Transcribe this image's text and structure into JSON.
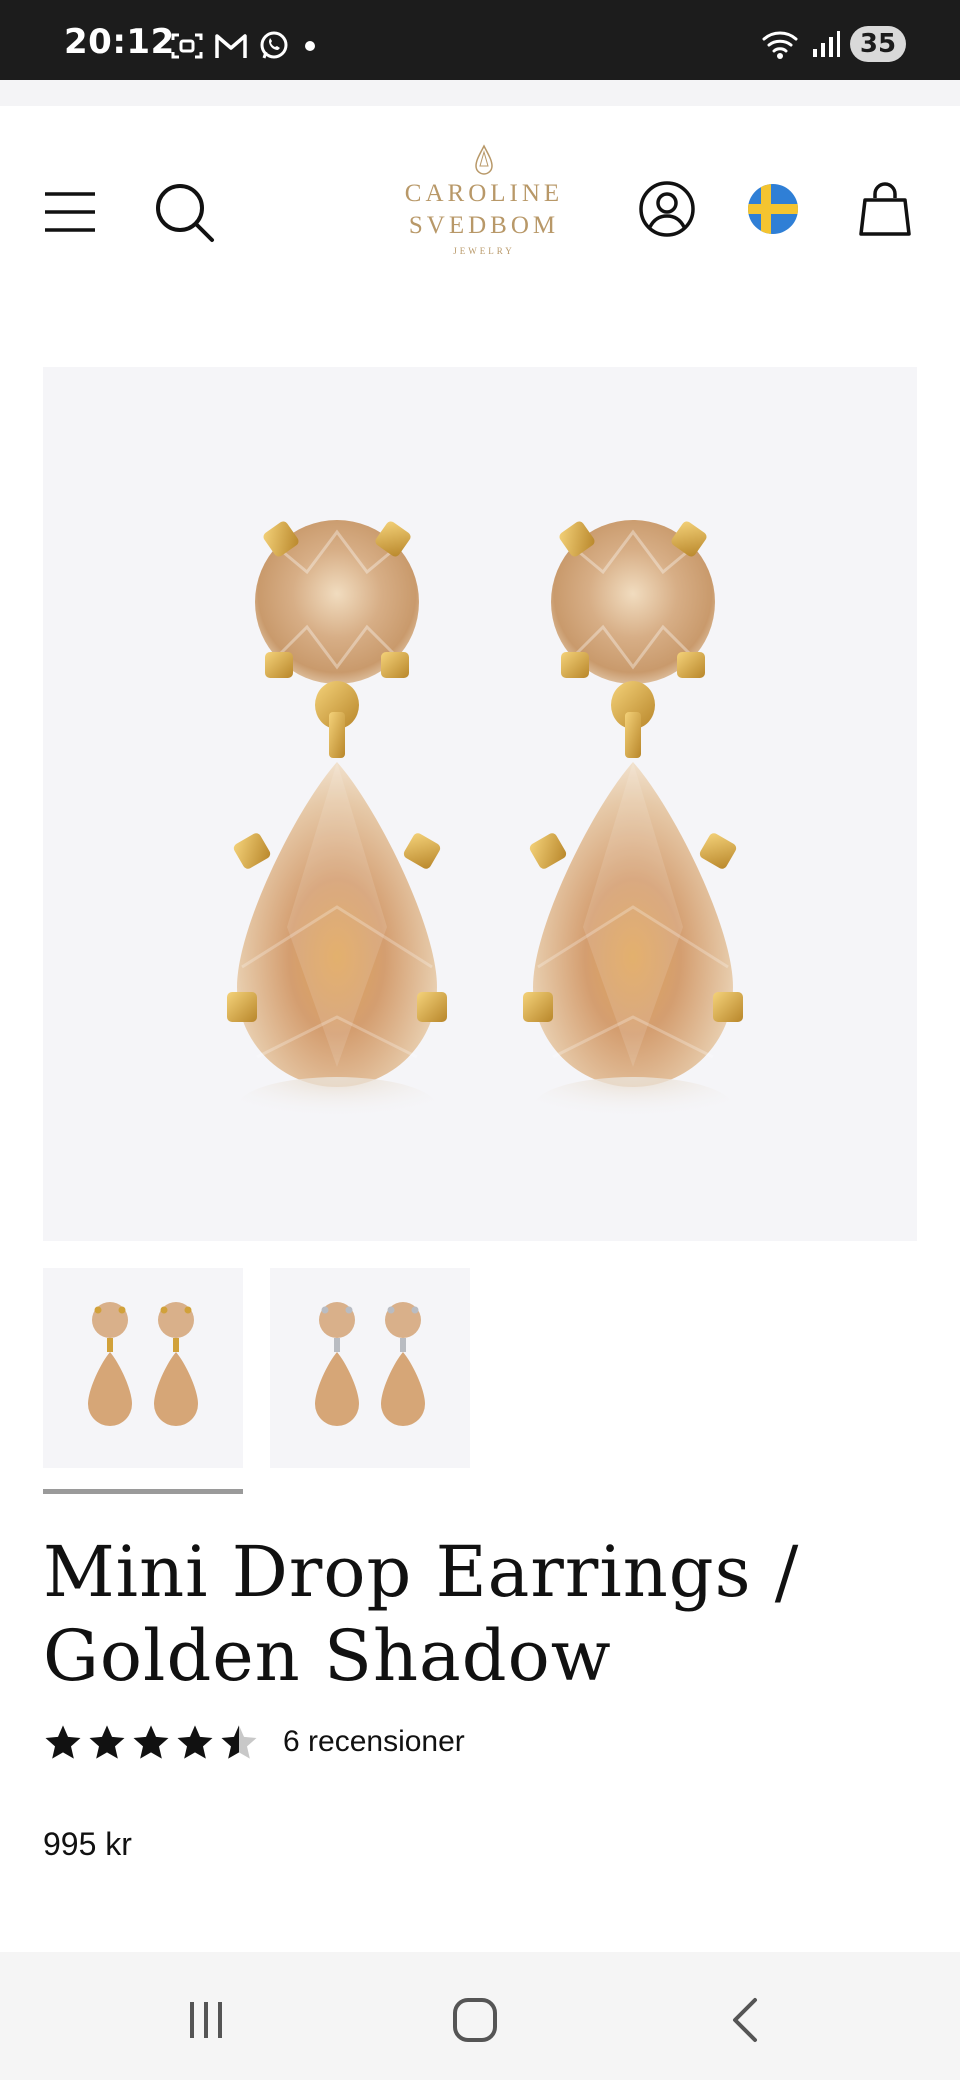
{
  "status_bar": {
    "time": "20:12",
    "battery": "35",
    "notification_icons": [
      "screenshot-icon",
      "gmail-icon",
      "whatsapp-icon",
      "dot-icon"
    ],
    "system_icons": [
      "wifi-icon",
      "signal-icon"
    ]
  },
  "header": {
    "menu_icon": "hamburger-menu-icon",
    "search_icon": "search-icon",
    "logo": {
      "line1": "CAROLINE",
      "line2": "SVEDBOM",
      "line3": "JEWELRY",
      "color": "#b89868"
    },
    "account_icon": "user-account-icon",
    "country_icon": "sweden-flag-icon",
    "cart_icon": "shopping-bag-icon"
  },
  "gallery": {
    "main_image": "earrings-image",
    "thumbnails": [
      {
        "name": "gold-earrings-thumbnail",
        "selected": true
      },
      {
        "name": "silver-earrings-thumbnail",
        "selected": false
      }
    ]
  },
  "product": {
    "title_line1": "Mini Drop Earrings /",
    "title_line2": "Golden Shadow",
    "rating": 4.5,
    "reviews": "6 recensioner",
    "price": "995 kr"
  },
  "nav_bar": {
    "recent_icon": "recent-apps-icon",
    "home_icon": "home-icon",
    "back_icon": "back-icon"
  },
  "colors": {
    "status_bar": "#1c1c1c",
    "image_bg": "#f5f5f8",
    "gold": "#d9a836",
    "crystal": "#dcb48c"
  }
}
